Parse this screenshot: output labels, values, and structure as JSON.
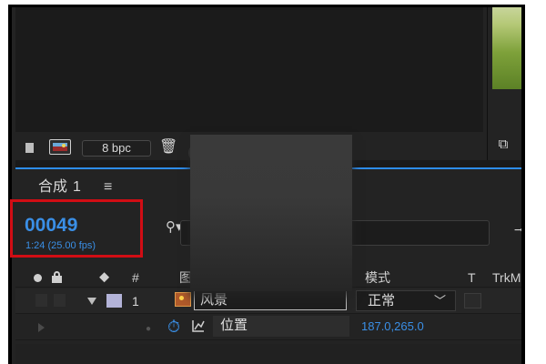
{
  "viewer": {
    "bit_depth": "8 bpc"
  },
  "timeline": {
    "comp_name": "合成",
    "comp_number": "1",
    "timecode": "00049",
    "fps_info": "1:24 (25.00 fps)",
    "columns": {
      "num": "#",
      "name_partial": "图",
      "mode": "模式",
      "t": "T",
      "trkmat": "TrkM"
    },
    "layer": {
      "number": "1",
      "name": "风景",
      "mode": "正常"
    },
    "property": {
      "name": "位置",
      "value": "187.0,265.0"
    }
  },
  "colors": {
    "accent_blue": "#3a8fe6",
    "highlight_red": "#d10d14",
    "panel_bg": "#232323"
  }
}
